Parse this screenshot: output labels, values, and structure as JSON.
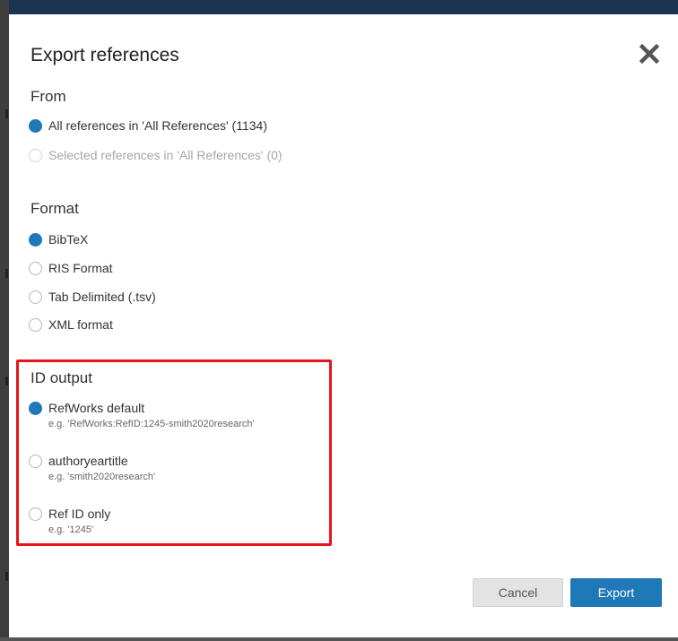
{
  "dialog": {
    "title": "Export references",
    "close_icon": "close-x-icon"
  },
  "from": {
    "label": "From",
    "options": [
      {
        "label": "All references in 'All References' (1134)",
        "checked": true,
        "disabled": false
      },
      {
        "label": "Selected references in 'All References' (0)",
        "checked": false,
        "disabled": true
      }
    ]
  },
  "format": {
    "label": "Format",
    "options": [
      {
        "label": "BibTeX",
        "checked": true
      },
      {
        "label": "RIS Format",
        "checked": false
      },
      {
        "label": "Tab Delimited (.tsv)",
        "checked": false
      },
      {
        "label": "XML format",
        "checked": false
      }
    ]
  },
  "id_output": {
    "label": "ID output",
    "options": [
      {
        "label": "RefWorks default",
        "example": "e.g. 'RefWorks:RefID:1245-smith2020research'",
        "checked": true
      },
      {
        "label": "authoryeartitle",
        "example": "e.g. 'smith2020research'",
        "checked": false
      },
      {
        "label": "Ref ID only",
        "example": "e.g. '1245'",
        "checked": false
      }
    ]
  },
  "buttons": {
    "cancel": "Cancel",
    "export": "Export"
  },
  "colors": {
    "accent": "#1f78b8",
    "highlight": "#e8141c",
    "header_bar": "#1b3550"
  }
}
